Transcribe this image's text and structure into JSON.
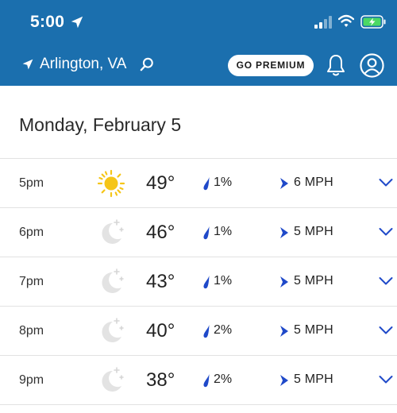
{
  "status_bar": {
    "time": "5:00",
    "icons": [
      "location-arrow-icon",
      "signal-icon",
      "wifi-icon",
      "battery-charging-icon"
    ]
  },
  "nav": {
    "location": "Arlington, VA",
    "premium_label": "GO PREMIUM",
    "icons": [
      "location-arrow-icon",
      "search-icon",
      "bell-icon",
      "account-icon"
    ]
  },
  "colors": {
    "header_bg": "#1b6fae",
    "accent_blue": "#1f49c9",
    "sun_yellow": "#f5c518",
    "battery_green": "#4cd964"
  },
  "date_heading": "Monday, February 5",
  "hours": [
    {
      "time": "5pm",
      "icon": "sun-icon",
      "temp": "49°",
      "precip": "1%",
      "wind": "6 MPH"
    },
    {
      "time": "6pm",
      "icon": "moon-icon",
      "temp": "46°",
      "precip": "1%",
      "wind": "5 MPH"
    },
    {
      "time": "7pm",
      "icon": "moon-icon",
      "temp": "43°",
      "precip": "1%",
      "wind": "5 MPH"
    },
    {
      "time": "8pm",
      "icon": "moon-icon",
      "temp": "40°",
      "precip": "2%",
      "wind": "5 MPH"
    },
    {
      "time": "9pm",
      "icon": "moon-icon",
      "temp": "38°",
      "precip": "2%",
      "wind": "5 MPH"
    }
  ]
}
